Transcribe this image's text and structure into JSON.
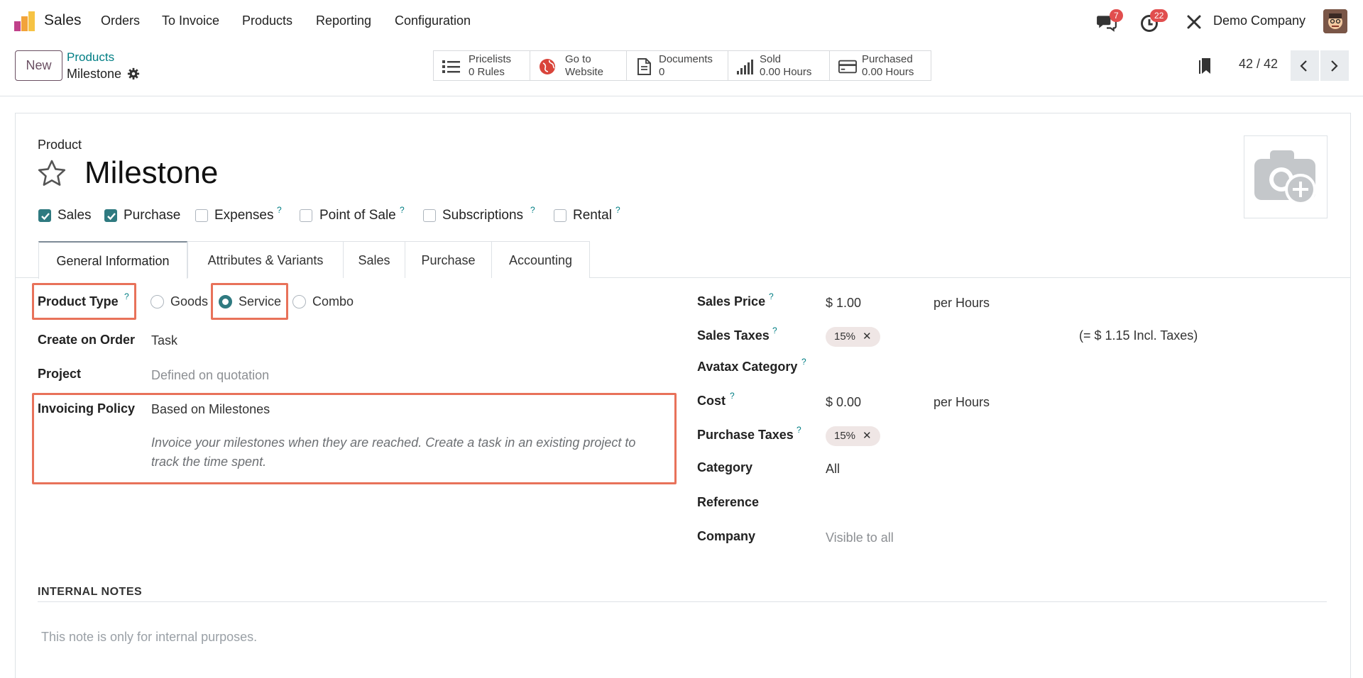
{
  "nav": {
    "app_name": "Sales",
    "menu": [
      "Orders",
      "To Invoice",
      "Products",
      "Reporting",
      "Configuration"
    ],
    "messages_count": "7",
    "activities_count": "22",
    "company": "Demo Company"
  },
  "control": {
    "new_label": "New",
    "breadcrumb_parent": "Products",
    "breadcrumb_current": "Milestone",
    "smart_buttons": [
      {
        "line1": "Pricelists",
        "line2": "0  Rules",
        "icon": "list-icon"
      },
      {
        "line1": "Go to",
        "line2": "Website",
        "icon": "globe-icon"
      },
      {
        "line1": "Documents",
        "line2": "0",
        "icon": "document-icon"
      },
      {
        "line1": "Sold",
        "line2": "0.00  Hours",
        "icon": "bar-chart-icon"
      },
      {
        "line1": "Purchased",
        "line2": "0.00  Hours",
        "icon": "credit-card-icon"
      }
    ],
    "pager": "42 / 42"
  },
  "product": {
    "label": "Product",
    "name": "Milestone",
    "checkboxes": [
      {
        "label": "Sales",
        "checked": true,
        "help": ""
      },
      {
        "label": "Purchase",
        "checked": true,
        "help": ""
      },
      {
        "label": "Expenses",
        "checked": false,
        "help": "?"
      },
      {
        "label": "Point of Sale",
        "checked": false,
        "help": "?"
      },
      {
        "label": "Subscriptions",
        "checked": false,
        "help": "?"
      },
      {
        "label": "Rental",
        "checked": false,
        "help": "?"
      }
    ]
  },
  "tabs": [
    "General Information",
    "Attributes & Variants",
    "Sales",
    "Purchase",
    "Accounting"
  ],
  "left": {
    "product_type_label": "Product Type",
    "product_type_options": [
      "Goods",
      "Service",
      "Combo"
    ],
    "product_type_selected": "Service",
    "create_on_order_label": "Create on Order",
    "create_on_order_value": "Task",
    "project_label": "Project",
    "project_placeholder": "Defined on quotation",
    "invoicing_policy_label": "Invoicing Policy",
    "invoicing_policy_value": "Based on Milestones",
    "invoicing_help_line1": "Invoice your milestones when they are reached. Create a task in an existing project to",
    "invoicing_help_line2": "track the time spent."
  },
  "right": {
    "sales_price_label": "Sales Price",
    "sales_price_value": "$ 1.00",
    "sales_price_uom": "per Hours",
    "sales_taxes_label": "Sales Taxes",
    "sales_tax_tag": "15%",
    "incl_taxes": "(= $ 1.15 Incl. Taxes)",
    "avatax_label": "Avatax Category",
    "cost_label": "Cost",
    "cost_value": "$ 0.00",
    "cost_uom": "per Hours",
    "purchase_taxes_label": "Purchase Taxes",
    "purchase_tax_tag": "15%",
    "category_label": "Category",
    "category_value": "All",
    "reference_label": "Reference",
    "company_label": "Company",
    "company_placeholder": "Visible to all"
  },
  "notes": {
    "header": "INTERNAL NOTES",
    "placeholder": "This note is only for internal purposes."
  },
  "help_mark": "?",
  "colors": {
    "accent": "#017e84",
    "primary": "#6a4f62",
    "highlight": "#e8725a",
    "checkbox": "#2f7a80"
  }
}
